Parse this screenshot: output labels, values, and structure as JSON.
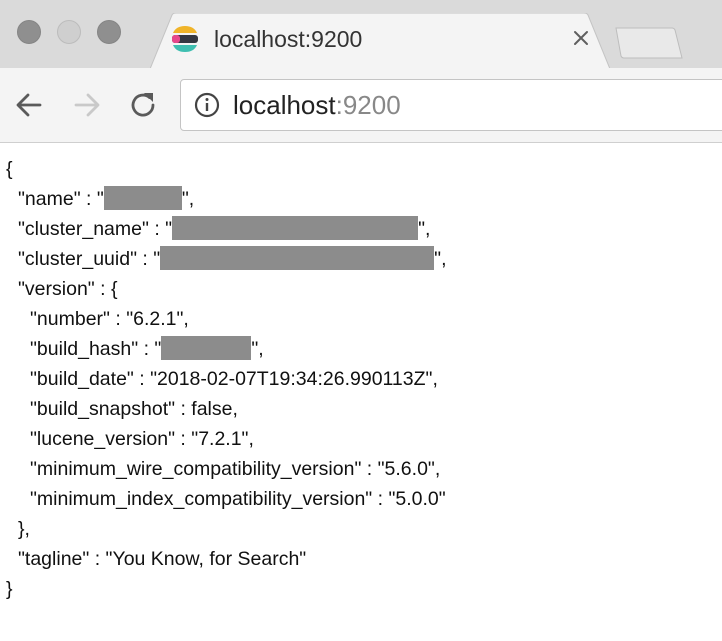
{
  "tab": {
    "title": "localhost:9200",
    "favicon": "elastic-logo-icon"
  },
  "toolbar": {
    "url_host": "localhost",
    "url_port": ":9200"
  },
  "json_view": {
    "open_brace": "{",
    "name_key": "\"name\" : \"",
    "name_close": "\",",
    "cluster_name_key": "\"cluster_name\" : \"",
    "cluster_name_close": "\",",
    "cluster_uuid_key": "\"cluster_uuid\" : \"",
    "cluster_uuid_close": "\",",
    "version_open": "\"version\" : {",
    "number_line": "\"number\" : \"6.2.1\",",
    "build_hash_key": "\"build_hash\" : \"",
    "build_hash_close": "\",",
    "build_date_line": "\"build_date\" : \"2018-02-07T19:34:26.990113Z\",",
    "build_snapshot_line": "\"build_snapshot\" : false,",
    "lucene_version_line": "\"lucene_version\" : \"7.2.1\",",
    "min_wire_line": "\"minimum_wire_compatibility_version\" : \"5.6.0\",",
    "min_index_line": "\"minimum_index_compatibility_version\" : \"5.0.0\"",
    "version_close": "},",
    "tagline_line": "\"tagline\" : \"You Know, for Search\"",
    "close_brace": "}"
  },
  "colors": {
    "tabstrip": "#dadada",
    "toolbar": "#f4f4f4",
    "redaction": "#8c8c8c"
  }
}
